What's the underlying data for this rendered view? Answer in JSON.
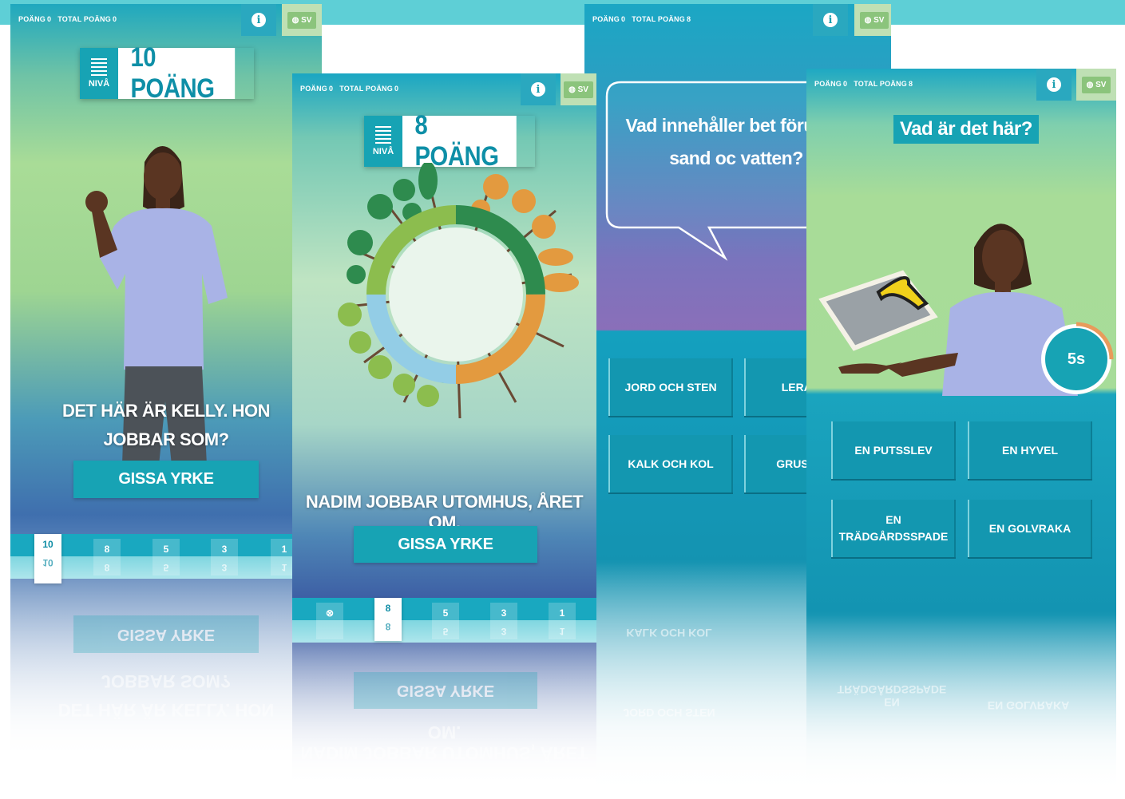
{
  "colors": {
    "brand": "#17a3b4",
    "light": "#5ecfd6",
    "green": "#8bc47c"
  },
  "panel1": {
    "pts_label": "POÄNG",
    "pts": "0",
    "total_label": "TOTAL POÄNG",
    "total": "0",
    "lang": "SV",
    "level_label": "NIVÅ",
    "points_text": "10 POÄNG",
    "caption": "DET HÄR ÄR KELLY. HON JOBBAR SOM?",
    "button": "GISSA YRKE",
    "track": [
      "10",
      "8",
      "5",
      "3",
      "1"
    ],
    "active_value": "10"
  },
  "panel2": {
    "pts_label": "POÄNG",
    "pts": "0",
    "total_label": "TOTAL POÄNG",
    "total": "0",
    "lang": "SV",
    "level_label": "NIVÅ",
    "points_text": "8 POÄNG",
    "caption": "NADIM JOBBAR UTOMHUS, ÅRET OM.",
    "button": "GISSA YRKE",
    "track": [
      "8",
      "5",
      "3",
      "1"
    ],
    "active_value": "8"
  },
  "panel3": {
    "pts_label": "POÄNG",
    "pts": "0",
    "total_label": "TOTAL POÄNG",
    "total": "8",
    "lang": "SV",
    "question": "Vad innehåller bet förutom sand oc vatten?",
    "answers": [
      "JORD OCH STEN",
      "LERA OC",
      "KALK OCH KOL",
      "GRUS CEM"
    ]
  },
  "panel4": {
    "pts_label": "POÄNG",
    "pts": "0",
    "total_label": "TOTAL POÄNG",
    "total": "8",
    "lang": "SV",
    "question": "Vad är det här?",
    "timer": "5s",
    "timer_fraction": 0.25,
    "answers": [
      "EN PUTSSLEV",
      "EN HYVEL",
      "EN TRÄDGÅRDSSPADE",
      "EN GOLVRAKA"
    ]
  }
}
